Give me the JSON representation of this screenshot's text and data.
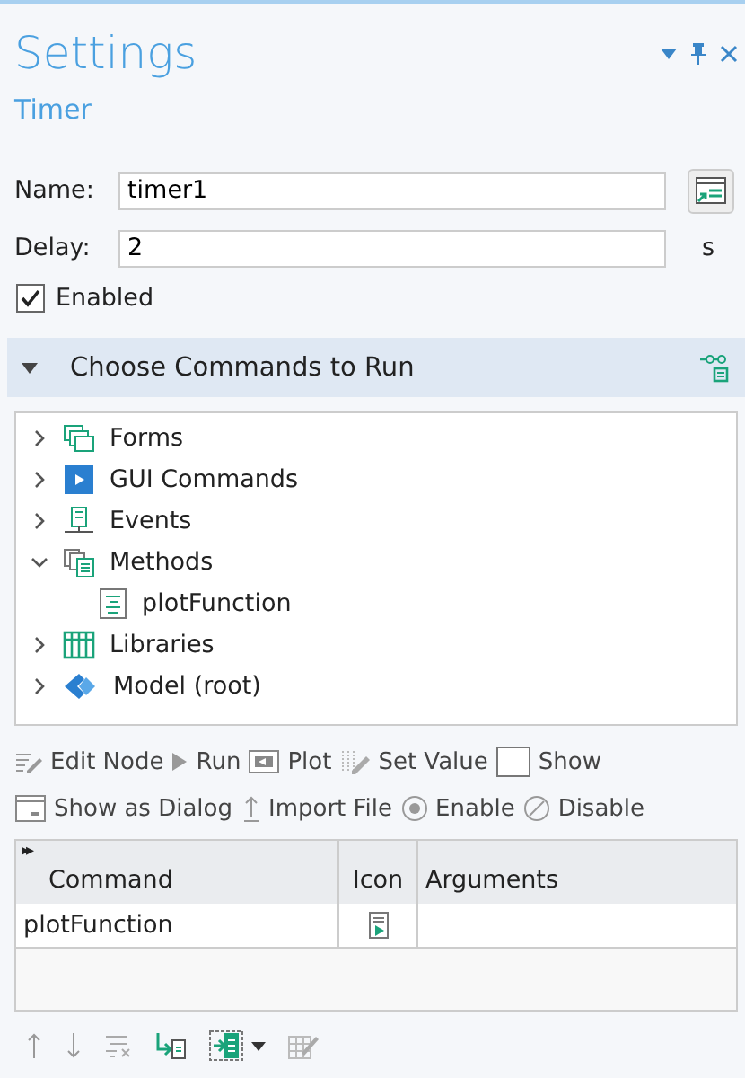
{
  "window": {
    "title": "Settings",
    "subtitle": "Timer"
  },
  "fields": [
    {
      "label": "Name:",
      "value": "timer1"
    },
    {
      "label": "Delay:",
      "value": "2",
      "unit": "s"
    }
  ],
  "enabled": {
    "label": "Enabled",
    "checked": true
  },
  "section": {
    "title": "Choose Commands to Run",
    "expanded": true
  },
  "tree": [
    {
      "label": "Forms",
      "kind": "forms",
      "expanded": false
    },
    {
      "label": "GUI Commands",
      "kind": "gui",
      "expanded": false
    },
    {
      "label": "Events",
      "kind": "events",
      "expanded": false
    },
    {
      "label": "Methods",
      "kind": "methods",
      "expanded": true,
      "children": [
        {
          "label": "plotFunction",
          "kind": "method"
        }
      ]
    },
    {
      "label": "Libraries",
      "kind": "libraries",
      "expanded": false
    },
    {
      "label": "Model (root)",
      "kind": "model",
      "expanded": false
    }
  ],
  "toolbar": [
    {
      "label": "Edit Node",
      "kind": "edit"
    },
    {
      "label": "Run",
      "kind": "run"
    },
    {
      "label": "Plot",
      "kind": "plot"
    },
    {
      "label": "Set Value",
      "kind": "set"
    },
    {
      "label": "Show",
      "kind": "show"
    },
    {
      "label": "Show as Dialog",
      "kind": "dialog"
    },
    {
      "label": "Import File",
      "kind": "import"
    },
    {
      "label": "Enable",
      "kind": "enable"
    },
    {
      "label": "Disable",
      "kind": "disable"
    }
  ],
  "table": {
    "header_icon": "▸▸",
    "columns": [
      "Command",
      "Icon",
      "Arguments"
    ],
    "rows": [
      {
        "command": "plotFunction"
      }
    ]
  }
}
